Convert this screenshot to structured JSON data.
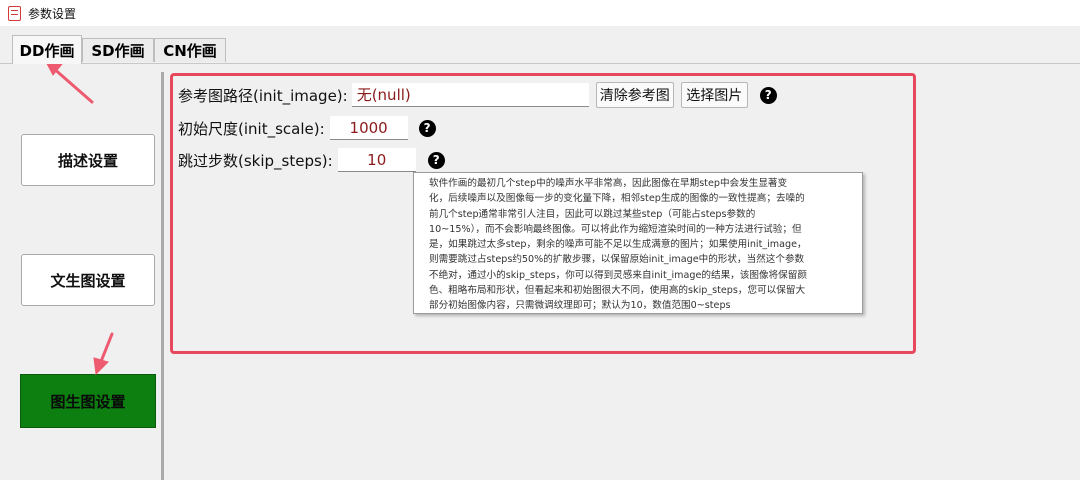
{
  "window": {
    "title": "参数设置"
  },
  "tabs": [
    {
      "label": "DD作画",
      "active": true
    },
    {
      "label": "SD作画",
      "active": false
    },
    {
      "label": "CN作画",
      "active": false
    }
  ],
  "nav": [
    {
      "label": "描述设置",
      "selected": false
    },
    {
      "label": "文生图设置",
      "selected": false
    },
    {
      "label": "图生图设置",
      "selected": true
    }
  ],
  "settings": {
    "init_image": {
      "label": "参考图路径(init_image):",
      "value": "无(null)",
      "clear_button": "清除参考图",
      "select_button": "选择图片"
    },
    "init_scale": {
      "label": "初始尺度(init_scale):",
      "value": "1000"
    },
    "skip_steps": {
      "label": "跳过步数(skip_steps):",
      "value": "10"
    },
    "help_icon_glyph": "?"
  },
  "tooltip": {
    "lines": [
      "软件作画的最初几个step中的噪声水平非常高，因此图像在早期step中会发生显著变",
      "化，后续噪声以及图像每一步的变化量下降，相邻step生成的图像的一致性提高；去噪的",
      "前几个step通常非常引人注目，因此可以跳过某些step（可能占steps参数的",
      "10~15%），而不会影响最终图像。可以将此作为缩短渲染时间的一种方法进行试验；但",
      "是，如果跳过太多step，剩余的噪声可能不足以生成满意的图片；如果使用init_image，",
      "则需要跳过占steps约50%的扩散步骤，以保留原始init_image中的形状，当然这个参数",
      "不绝对，通过小的skip_steps，你可以得到灵感来自init_image的结果，该图像将保留颜",
      "色、粗略布局和形状，但看起来和初始图很大不同，使用高的skip_steps，您可以保留大",
      "部分初始图像内容，只需微调纹理即可；默认为10，数值范围0~steps"
    ]
  },
  "colors": {
    "highlight_border": "#e8485e",
    "annotation_arrow": "#ee5a6f",
    "selected_nav": "#0c7f10",
    "value_text": "#8b1a1a"
  }
}
